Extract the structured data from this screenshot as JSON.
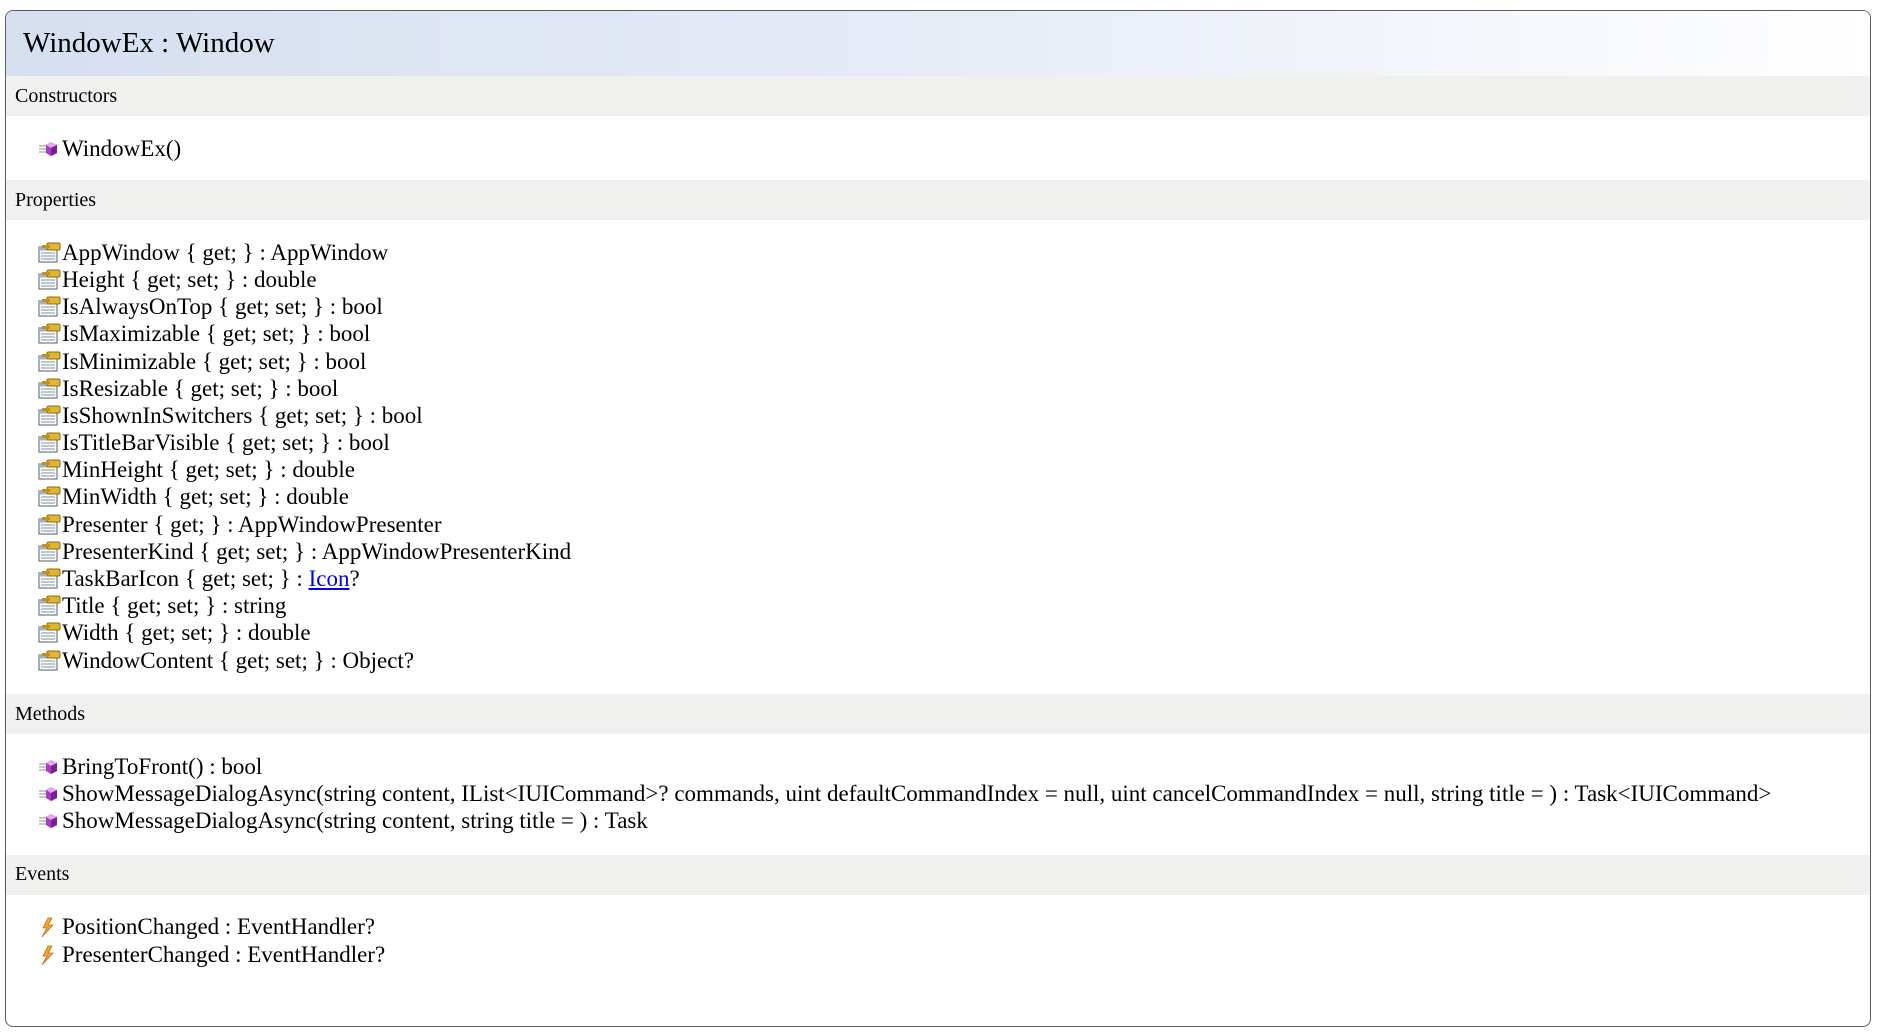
{
  "class_title": "WindowEx : Window",
  "sections": {
    "constructors": {
      "label": "Constructors",
      "items": [
        "WindowEx()"
      ]
    },
    "properties": {
      "label": "Properties",
      "items": [
        "AppWindow { get; } : AppWindow",
        "Height { get; set; } : double",
        "IsAlwaysOnTop { get; set; } : bool",
        "IsMaximizable { get; set; } : bool",
        "IsMinimizable { get; set; } : bool",
        "IsResizable { get; set; } : bool",
        "IsShownInSwitchers { get; set; } : bool",
        "IsTitleBarVisible { get; set; } : bool",
        "MinHeight { get; set; } : double",
        "MinWidth { get; set; } : double",
        "Presenter { get; } : AppWindowPresenter",
        "PresenterKind { get; set; } : AppWindowPresenterKind",
        "Title { get; set; } : string",
        "Width { get; set; } : double",
        "WindowContent { get; set; } : Object?"
      ],
      "taskbar_icon": {
        "prefix": "TaskBarIcon { get; set; } : ",
        "link": "Icon",
        "suffix": "?"
      }
    },
    "methods": {
      "label": "Methods",
      "items": [
        "BringToFront() : bool",
        "ShowMessageDialogAsync(string content, IList<IUICommand>? commands, uint defaultCommandIndex = null, uint cancelCommandIndex = null, string title = ) : Task<IUICommand>",
        "ShowMessageDialogAsync(string content, string title = ) : Task"
      ]
    },
    "events": {
      "label": "Events",
      "items": [
        "PositionChanged : EventHandler?",
        "PresenterChanged : EventHandler?"
      ]
    }
  },
  "icons": {
    "constructor": "method-icon",
    "property": "property-icon",
    "method": "method-icon",
    "event": "event-icon"
  },
  "colors": {
    "header_gradient_start": "#d6dff0",
    "section_bg": "#f0f1ef",
    "border": "#5e5e5e",
    "link": "#0000ee"
  }
}
